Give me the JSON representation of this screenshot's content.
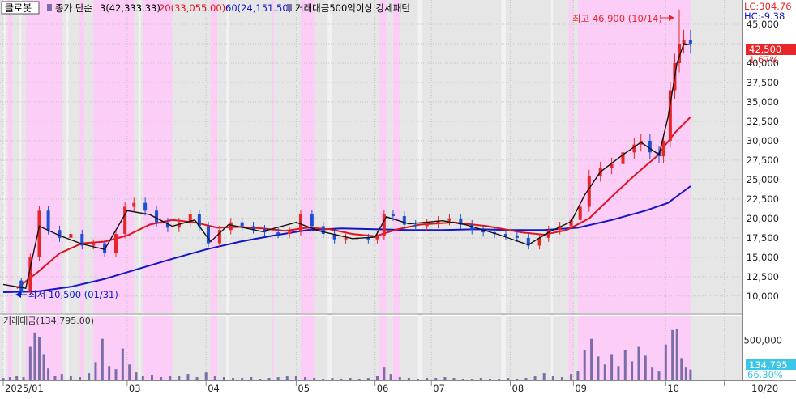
{
  "stock": {
    "name": "클로봇"
  },
  "legend": {
    "ma_label": "종가 단순",
    "ma3_text": "3(42,333.33)",
    "ma20_text": "20(33,055.00)",
    "ma60_text": "60(24,151.50)",
    "pattern_text": "거래대금500억이상 강세패턴",
    "volume_text": "거래대금(134,795.00)"
  },
  "info": {
    "lc": "LC:304.76",
    "hc": "HC:-9.38",
    "price_tag": "42,500",
    "pct_text": "1.67%",
    "vol_tag": "134,795",
    "vol_pct": "66.30%"
  },
  "annotations": {
    "high_text": "최고 46,900 (10/14)",
    "low_text": "최저 10,500 (01/31)"
  },
  "colors": {
    "up": "#e8262a",
    "down": "#1c4fd4",
    "ma3": "#111111",
    "ma20": "#e0141e",
    "ma60": "#1414c8",
    "highlight": "#fbcdf7",
    "volume_bar": "#7a6ea8",
    "tag_red": "#e8262a",
    "tag_cyan": "#3bc6e8"
  },
  "chart_data": {
    "type": "candlestick",
    "title": "클로봇",
    "price_axis": {
      "ticks": [
        10000,
        12500,
        15000,
        17500,
        20000,
        22500,
        25000,
        27500,
        30000,
        32500,
        35000,
        37500,
        40000,
        42500,
        45000
      ],
      "tick_labels": [
        "10,000",
        "12,500",
        "15,000",
        "17,500",
        "20,000",
        "22,500",
        "25,000",
        "27,500",
        "30,000",
        "32,500",
        "35,000",
        "37,500",
        "40,000",
        "42,500",
        "45,000"
      ],
      "range": [
        8000,
        47500
      ]
    },
    "volume_axis": {
      "ticks": [
        500000
      ],
      "tick_labels": [
        "500,000"
      ],
      "range": [
        0,
        750000
      ]
    },
    "date_axis": {
      "labels": [
        "2025/01",
        "03",
        "04",
        "05",
        "06",
        "07",
        "08",
        "09",
        "10",
        "10/20"
      ],
      "label_days": [
        0,
        55,
        90,
        130,
        165,
        190,
        225,
        253,
        294,
        320
      ]
    },
    "price_series": [
      {
        "day": 0,
        "value": 12000
      },
      {
        "day": 8,
        "value": 10500
      },
      {
        "day": 12,
        "value": 15000
      },
      {
        "day": 16,
        "value": 21000
      },
      {
        "day": 20,
        "value": 18500
      },
      {
        "day": 25,
        "value": 17500
      },
      {
        "day": 30,
        "value": 18000
      },
      {
        "day": 35,
        "value": 16500
      },
      {
        "day": 40,
        "value": 16800
      },
      {
        "day": 45,
        "value": 15500
      },
      {
        "day": 50,
        "value": 18000
      },
      {
        "day": 54,
        "value": 21500
      },
      {
        "day": 58,
        "value": 22000
      },
      {
        "day": 63,
        "value": 21000
      },
      {
        "day": 68,
        "value": 19500
      },
      {
        "day": 73,
        "value": 18800
      },
      {
        "day": 78,
        "value": 19500
      },
      {
        "day": 83,
        "value": 20500
      },
      {
        "day": 87,
        "value": 19000
      },
      {
        "day": 91,
        "value": 16800
      },
      {
        "day": 96,
        "value": 18500
      },
      {
        "day": 101,
        "value": 19500
      },
      {
        "day": 106,
        "value": 19000
      },
      {
        "day": 111,
        "value": 18600
      },
      {
        "day": 116,
        "value": 18200
      },
      {
        "day": 122,
        "value": 18000
      },
      {
        "day": 127,
        "value": 18300
      },
      {
        "day": 132,
        "value": 20500
      },
      {
        "day": 137,
        "value": 19000
      },
      {
        "day": 142,
        "value": 18000
      },
      {
        "day": 147,
        "value": 17300
      },
      {
        "day": 152,
        "value": 17500
      },
      {
        "day": 157,
        "value": 17500
      },
      {
        "day": 162,
        "value": 17300
      },
      {
        "day": 166,
        "value": 17800
      },
      {
        "day": 169,
        "value": 20500
      },
      {
        "day": 173,
        "value": 20300
      },
      {
        "day": 178,
        "value": 19200
      },
      {
        "day": 183,
        "value": 19000
      },
      {
        "day": 188,
        "value": 19300
      },
      {
        "day": 193,
        "value": 19700
      },
      {
        "day": 198,
        "value": 20000
      },
      {
        "day": 203,
        "value": 19200
      },
      {
        "day": 208,
        "value": 18500
      },
      {
        "day": 213,
        "value": 18200
      },
      {
        "day": 218,
        "value": 18000
      },
      {
        "day": 223,
        "value": 17800
      },
      {
        "day": 228,
        "value": 17500
      },
      {
        "day": 233,
        "value": 16500
      },
      {
        "day": 238,
        "value": 17500
      },
      {
        "day": 242,
        "value": 18500
      },
      {
        "day": 247,
        "value": 19000
      },
      {
        "day": 252,
        "value": 19800
      },
      {
        "day": 256,
        "value": 21500
      },
      {
        "day": 260,
        "value": 25500
      },
      {
        "day": 265,
        "value": 26500
      },
      {
        "day": 270,
        "value": 27000
      },
      {
        "day": 275,
        "value": 28500
      },
      {
        "day": 280,
        "value": 29500
      },
      {
        "day": 283,
        "value": 30000
      },
      {
        "day": 287,
        "value": 28500
      },
      {
        "day": 291,
        "value": 28000
      },
      {
        "day": 293,
        "value": 30000
      },
      {
        "day": 296,
        "value": 36500
      },
      {
        "day": 298,
        "value": 40000
      },
      {
        "day": 300,
        "value": 42500
      },
      {
        "day": 302,
        "value": 43000
      },
      {
        "day": 305,
        "value": 42500
      }
    ],
    "ma3": {
      "name": "3",
      "last": 42333.33,
      "points": [
        {
          "day": 0,
          "value": 11500
        },
        {
          "day": 10,
          "value": 11000
        },
        {
          "day": 16,
          "value": 19000
        },
        {
          "day": 25,
          "value": 17800
        },
        {
          "day": 35,
          "value": 16700
        },
        {
          "day": 45,
          "value": 16000
        },
        {
          "day": 55,
          "value": 21000
        },
        {
          "day": 65,
          "value": 20500
        },
        {
          "day": 75,
          "value": 19000
        },
        {
          "day": 85,
          "value": 19800
        },
        {
          "day": 92,
          "value": 17000
        },
        {
          "day": 100,
          "value": 19200
        },
        {
          "day": 115,
          "value": 18300
        },
        {
          "day": 130,
          "value": 19500
        },
        {
          "day": 140,
          "value": 18400
        },
        {
          "day": 155,
          "value": 17400
        },
        {
          "day": 165,
          "value": 17600
        },
        {
          "day": 170,
          "value": 20200
        },
        {
          "day": 180,
          "value": 19300
        },
        {
          "day": 195,
          "value": 19700
        },
        {
          "day": 205,
          "value": 19200
        },
        {
          "day": 220,
          "value": 17900
        },
        {
          "day": 233,
          "value": 16600
        },
        {
          "day": 242,
          "value": 18200
        },
        {
          "day": 252,
          "value": 19600
        },
        {
          "day": 258,
          "value": 23000
        },
        {
          "day": 265,
          "value": 26000
        },
        {
          "day": 275,
          "value": 28200
        },
        {
          "day": 283,
          "value": 29800
        },
        {
          "day": 291,
          "value": 28200
        },
        {
          "day": 295,
          "value": 33000
        },
        {
          "day": 299,
          "value": 40000
        },
        {
          "day": 302,
          "value": 42500
        },
        {
          "day": 305,
          "value": 42333
        }
      ]
    },
    "ma20": {
      "name": "20",
      "last": 33055.0,
      "points": [
        {
          "day": 6,
          "value": 11000
        },
        {
          "day": 15,
          "value": 13000
        },
        {
          "day": 25,
          "value": 15500
        },
        {
          "day": 35,
          "value": 16800
        },
        {
          "day": 45,
          "value": 17000
        },
        {
          "day": 55,
          "value": 17800
        },
        {
          "day": 65,
          "value": 19200
        },
        {
          "day": 75,
          "value": 19800
        },
        {
          "day": 85,
          "value": 19500
        },
        {
          "day": 95,
          "value": 18800
        },
        {
          "day": 105,
          "value": 18900
        },
        {
          "day": 115,
          "value": 18700
        },
        {
          "day": 125,
          "value": 18400
        },
        {
          "day": 135,
          "value": 18800
        },
        {
          "day": 145,
          "value": 18600
        },
        {
          "day": 155,
          "value": 18000
        },
        {
          "day": 165,
          "value": 17700
        },
        {
          "day": 175,
          "value": 18600
        },
        {
          "day": 185,
          "value": 19200
        },
        {
          "day": 200,
          "value": 19500
        },
        {
          "day": 215,
          "value": 19000
        },
        {
          "day": 230,
          "value": 18200
        },
        {
          "day": 240,
          "value": 17900
        },
        {
          "day": 250,
          "value": 18500
        },
        {
          "day": 260,
          "value": 20000
        },
        {
          "day": 270,
          "value": 22800
        },
        {
          "day": 280,
          "value": 25500
        },
        {
          "day": 290,
          "value": 28000
        },
        {
          "day": 298,
          "value": 31000
        },
        {
          "day": 305,
          "value": 33055
        }
      ]
    },
    "ma60": {
      "name": "60",
      "last": 24151.5,
      "points": [
        {
          "day": 0,
          "value": 10500
        },
        {
          "day": 15,
          "value": 10600
        },
        {
          "day": 30,
          "value": 11200
        },
        {
          "day": 45,
          "value": 12200
        },
        {
          "day": 60,
          "value": 13500
        },
        {
          "day": 75,
          "value": 14800
        },
        {
          "day": 90,
          "value": 16000
        },
        {
          "day": 105,
          "value": 17000
        },
        {
          "day": 120,
          "value": 17800
        },
        {
          "day": 135,
          "value": 18500
        },
        {
          "day": 150,
          "value": 18700
        },
        {
          "day": 165,
          "value": 18600
        },
        {
          "day": 180,
          "value": 18500
        },
        {
          "day": 195,
          "value": 18500
        },
        {
          "day": 210,
          "value": 18600
        },
        {
          "day": 225,
          "value": 18500
        },
        {
          "day": 240,
          "value": 18500
        },
        {
          "day": 255,
          "value": 18800
        },
        {
          "day": 270,
          "value": 19800
        },
        {
          "day": 285,
          "value": 21000
        },
        {
          "day": 295,
          "value": 22000
        },
        {
          "day": 305,
          "value": 24151
        }
      ]
    },
    "volume": [
      {
        "day": 0,
        "value": 30000
      },
      {
        "day": 3,
        "value": 40000
      },
      {
        "day": 6,
        "value": 60000
      },
      {
        "day": 9,
        "value": 40000
      },
      {
        "day": 12,
        "value": 420000
      },
      {
        "day": 14,
        "value": 600000
      },
      {
        "day": 16,
        "value": 540000
      },
      {
        "day": 18,
        "value": 320000
      },
      {
        "day": 20,
        "value": 150000
      },
      {
        "day": 23,
        "value": 60000
      },
      {
        "day": 26,
        "value": 80000
      },
      {
        "day": 30,
        "value": 50000
      },
      {
        "day": 34,
        "value": 40000
      },
      {
        "day": 38,
        "value": 90000
      },
      {
        "day": 41,
        "value": 230000
      },
      {
        "day": 44,
        "value": 520000
      },
      {
        "day": 47,
        "value": 180000
      },
      {
        "day": 50,
        "value": 140000
      },
      {
        "day": 53,
        "value": 400000
      },
      {
        "day": 56,
        "value": 200000
      },
      {
        "day": 59,
        "value": 100000
      },
      {
        "day": 62,
        "value": 60000
      },
      {
        "day": 66,
        "value": 70000
      },
      {
        "day": 70,
        "value": 40000
      },
      {
        "day": 74,
        "value": 50000
      },
      {
        "day": 78,
        "value": 60000
      },
      {
        "day": 82,
        "value": 80000
      },
      {
        "day": 86,
        "value": 40000
      },
      {
        "day": 90,
        "value": 100000
      },
      {
        "day": 94,
        "value": 50000
      },
      {
        "day": 98,
        "value": 40000
      },
      {
        "day": 102,
        "value": 30000
      },
      {
        "day": 106,
        "value": 30000
      },
      {
        "day": 110,
        "value": 40000
      },
      {
        "day": 114,
        "value": 20000
      },
      {
        "day": 118,
        "value": 30000
      },
      {
        "day": 122,
        "value": 40000
      },
      {
        "day": 126,
        "value": 50000
      },
      {
        "day": 130,
        "value": 60000
      },
      {
        "day": 134,
        "value": 40000
      },
      {
        "day": 138,
        "value": 30000
      },
      {
        "day": 142,
        "value": 20000
      },
      {
        "day": 146,
        "value": 30000
      },
      {
        "day": 150,
        "value": 20000
      },
      {
        "day": 154,
        "value": 30000
      },
      {
        "day": 158,
        "value": 20000
      },
      {
        "day": 162,
        "value": 30000
      },
      {
        "day": 166,
        "value": 60000
      },
      {
        "day": 169,
        "value": 160000
      },
      {
        "day": 172,
        "value": 80000
      },
      {
        "day": 176,
        "value": 40000
      },
      {
        "day": 180,
        "value": 30000
      },
      {
        "day": 184,
        "value": 20000
      },
      {
        "day": 188,
        "value": 30000
      },
      {
        "day": 192,
        "value": 30000
      },
      {
        "day": 196,
        "value": 40000
      },
      {
        "day": 200,
        "value": 30000
      },
      {
        "day": 204,
        "value": 20000
      },
      {
        "day": 208,
        "value": 20000
      },
      {
        "day": 212,
        "value": 30000
      },
      {
        "day": 216,
        "value": 20000
      },
      {
        "day": 220,
        "value": 20000
      },
      {
        "day": 224,
        "value": 30000
      },
      {
        "day": 228,
        "value": 20000
      },
      {
        "day": 232,
        "value": 30000
      },
      {
        "day": 236,
        "value": 50000
      },
      {
        "day": 240,
        "value": 90000
      },
      {
        "day": 244,
        "value": 60000
      },
      {
        "day": 248,
        "value": 40000
      },
      {
        "day": 252,
        "value": 80000
      },
      {
        "day": 255,
        "value": 120000
      },
      {
        "day": 258,
        "value": 380000
      },
      {
        "day": 261,
        "value": 520000
      },
      {
        "day": 264,
        "value": 300000
      },
      {
        "day": 267,
        "value": 200000
      },
      {
        "day": 270,
        "value": 320000
      },
      {
        "day": 273,
        "value": 180000
      },
      {
        "day": 276,
        "value": 380000
      },
      {
        "day": 279,
        "value": 240000
      },
      {
        "day": 282,
        "value": 420000
      },
      {
        "day": 285,
        "value": 310000
      },
      {
        "day": 288,
        "value": 160000
      },
      {
        "day": 291,
        "value": 110000
      },
      {
        "day": 294,
        "value": 450000
      },
      {
        "day": 297,
        "value": 630000
      },
      {
        "day": 299,
        "value": 640000
      },
      {
        "day": 301,
        "value": 280000
      },
      {
        "day": 303,
        "value": 160000
      },
      {
        "day": 305,
        "value": 135000
      }
    ],
    "highlight_ranges": [
      [
        2,
        4
      ],
      [
        10,
        26
      ],
      [
        34,
        36
      ],
      [
        40,
        58
      ],
      [
        62,
        75
      ],
      [
        92,
        95
      ],
      [
        119,
        120
      ],
      [
        132,
        138
      ],
      [
        167,
        170
      ],
      [
        173,
        176
      ],
      [
        251,
        253
      ],
      [
        255,
        305
      ]
    ],
    "highlight_band_ranges": [
      [
        0,
        1
      ],
      [
        7,
        8
      ],
      [
        28,
        29
      ],
      [
        60,
        61
      ],
      [
        99,
        100
      ],
      [
        144,
        146
      ],
      [
        184,
        186
      ],
      [
        221,
        223
      ],
      [
        243,
        244
      ]
    ],
    "extremes": {
      "high": {
        "value": 46900,
        "date": "10/14"
      },
      "low": {
        "value": 10500,
        "date": "01/31"
      }
    }
  }
}
